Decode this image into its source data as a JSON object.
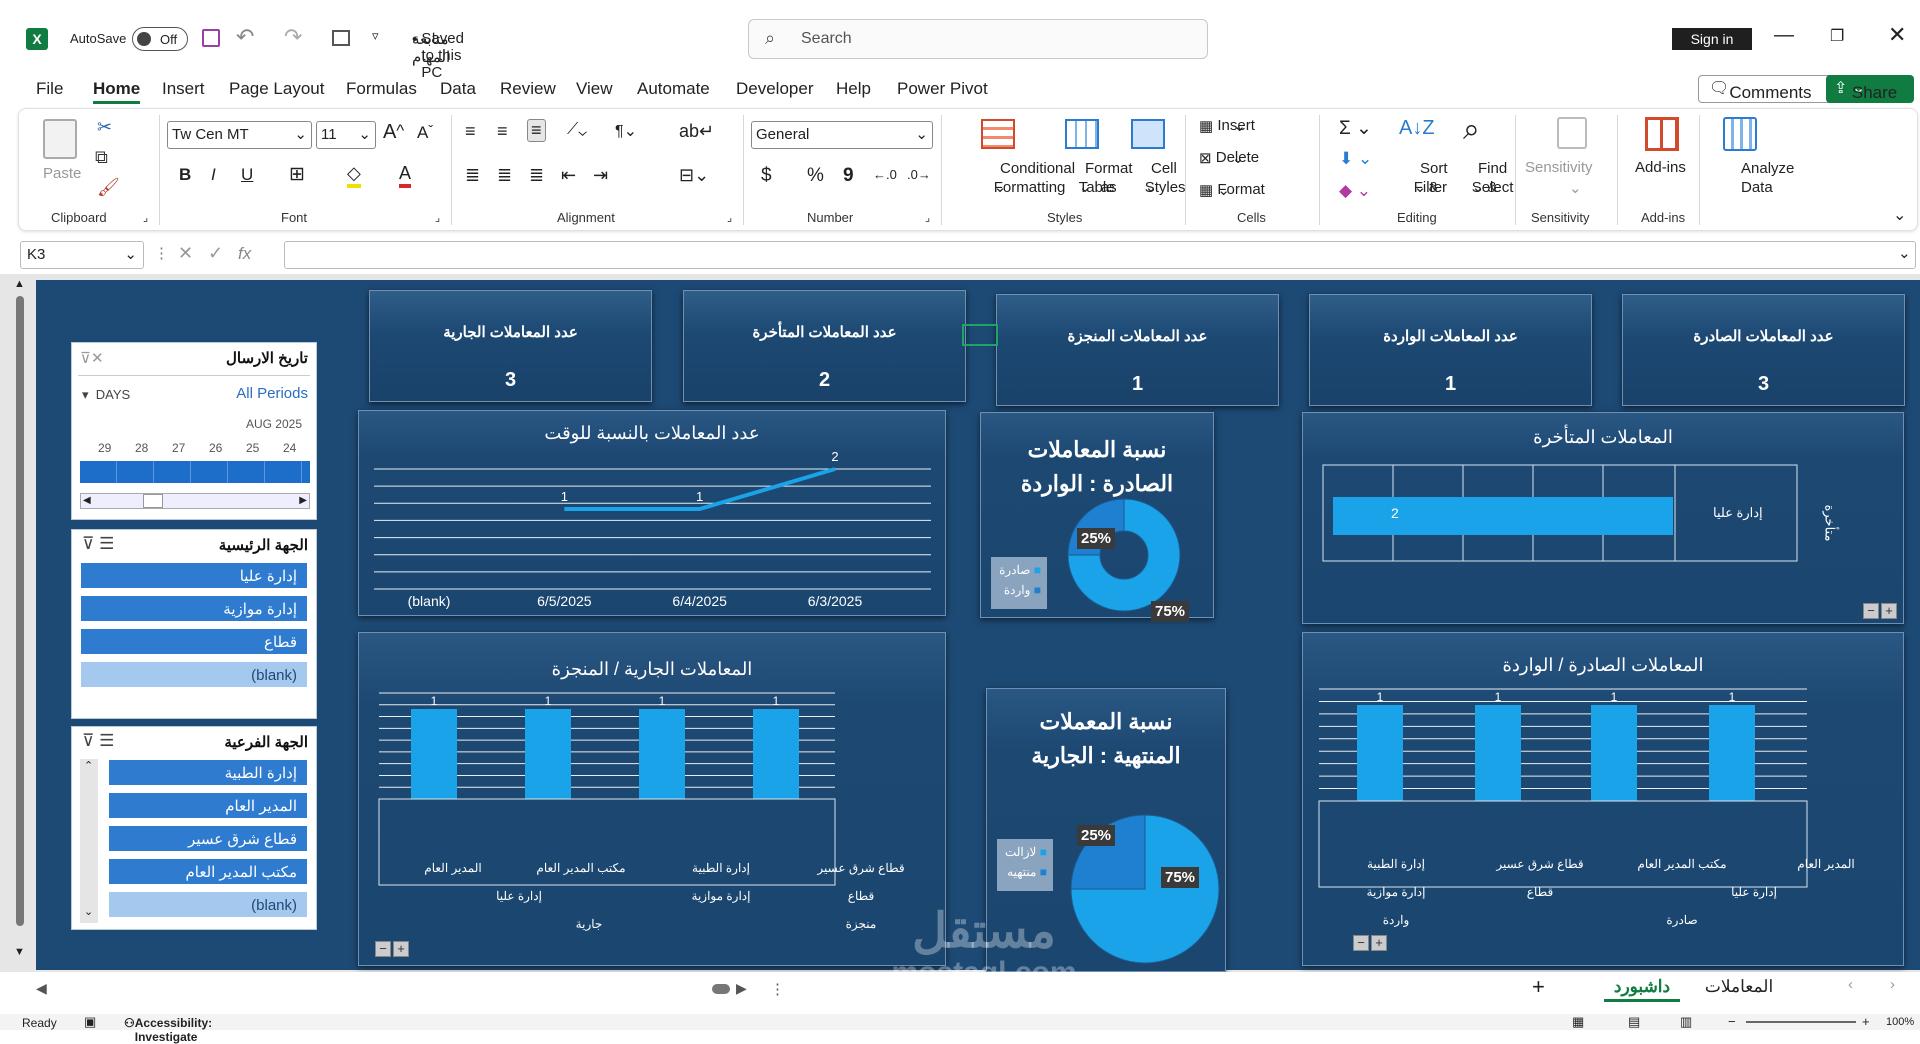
{
  "titlebar": {
    "autosave_label": "AutoSave",
    "autosave_state": "Off",
    "doc_title": "متابعة المهام",
    "saved_status": "Saved to this PC",
    "search_placeholder": "Search",
    "sign_in": "Sign in"
  },
  "menu": [
    "File",
    "Home",
    "Insert",
    "Page Layout",
    "Formulas",
    "Data",
    "Review",
    "View",
    "Automate",
    "Developer",
    "Help",
    "Power Pivot"
  ],
  "header_buttons": {
    "comments": "Comments",
    "share": "Share"
  },
  "ribbon": {
    "clipboard": {
      "paste": "Paste",
      "group": "Clipboard"
    },
    "font": {
      "name": "Tw Cen MT",
      "size": "11",
      "group": "Font",
      "bold": "B",
      "italic": "I",
      "underline": "U"
    },
    "alignment": {
      "group": "Alignment"
    },
    "number": {
      "format": "General",
      "currency": "$",
      "percent": "%",
      "comma": "9",
      "group": "Number"
    },
    "styles": {
      "cond1": "Conditional",
      "cond2": "Formatting",
      "fmt1": "Format as",
      "fmt2": "Table",
      "cell1": "Cell",
      "cell2": "Styles",
      "group": "Styles"
    },
    "cells": {
      "insert": "Insert",
      "delete": "Delete",
      "format": "Format",
      "group": "Cells"
    },
    "editing": {
      "sort1": "Sort &",
      "sort2": "Filter",
      "find1": "Find &",
      "find2": "Select",
      "group": "Editing"
    },
    "sensitivity": {
      "label": "Sensitivity",
      "group": "Sensitivity"
    },
    "addins": {
      "label": "Add-ins",
      "group": "Add-ins"
    },
    "analyze": {
      "l1": "Analyze",
      "l2": "Data"
    }
  },
  "formula_bar": {
    "name_box": "K3",
    "fx": "fx",
    "value": ""
  },
  "dashboard": {
    "cards": [
      {
        "title": "عدد المعاملات الجارية",
        "value": "3"
      },
      {
        "title": "عدد المعاملات المتأخرة",
        "value": "2"
      },
      {
        "title": "عدد المعاملات المنجزة",
        "value": "1"
      },
      {
        "title": "عدد المعاملات الواردة",
        "value": "1"
      },
      {
        "title": "عدد المعاملات الصادرة",
        "value": "3"
      }
    ],
    "slicer_date": {
      "title": "تاريخ الارسال",
      "level": "DAYS",
      "all_periods": "All Periods",
      "month": "AUG 2025",
      "days": [
        "29",
        "28",
        "27",
        "26",
        "25",
        "24"
      ]
    },
    "slicer_main": {
      "title": "الجهة الرئيسية",
      "items": [
        "إدارة عليا",
        "إدارة موازية",
        "قطاع",
        "(blank)"
      ]
    },
    "slicer_sub": {
      "title": "الجهة الفرعية",
      "items": [
        "إدارة الطبية",
        "المدير العام",
        "قطاع شرق عسير",
        "مكتب المدير العام",
        "(blank)"
      ]
    },
    "line_panel": {
      "title": "عدد المعاملات بالنسبة للوقت"
    },
    "donut1": {
      "title1": "نسبة المعاملات",
      "title2": "الصادرة : الواردة",
      "legend": [
        "صادرة",
        "واردة"
      ],
      "label_small": "25%",
      "label_big": "75%"
    },
    "donut2": {
      "title1": "نسبة المعملات",
      "title2": "المنتهية : الجارية",
      "legend": [
        "لازالت",
        "منتهيه"
      ],
      "label_small": "25%",
      "label_big": "75%"
    },
    "late_panel": {
      "title": "المعاملات المتأخرة",
      "row_label": "إدارة عليا",
      "axis_title": "متأخرة",
      "value_label": "2"
    },
    "bar1_panel": {
      "title": "المعاملات الجارية / المنجزة",
      "sub_labels": [
        "المدير العام",
        "مكتب المدير العام",
        "إدارة الطبية",
        "قطاع شرق عسير"
      ],
      "grp_labels": [
        "إدارة عليا",
        "إدارة موازية",
        "قطاع"
      ],
      "top_labels": [
        "جارية",
        "منجزة"
      ]
    },
    "bar2_panel": {
      "title": "المعاملات الصادرة / الواردة",
      "sub_labels": [
        "إدارة الطبية",
        "قطاع شرق عسير",
        "مكتب المدير العام",
        "المدير العام"
      ],
      "grp_labels": [
        "إدارة موازية",
        "قطاع",
        "إدارة عليا"
      ],
      "top_labels": [
        "واردة",
        "صادرة"
      ]
    }
  },
  "chart_data": [
    {
      "type": "line",
      "title": "عدد المعاملات بالنسبة للوقت",
      "categories": [
        "(blank)",
        "6/5/2025",
        "6/4/2025",
        "6/3/2025"
      ],
      "values": [
        null,
        1,
        1,
        2
      ]
    },
    {
      "type": "pie",
      "title": "نسبة المعاملات الصادرة : الواردة",
      "categories": [
        "صادرة",
        "واردة"
      ],
      "values": [
        75,
        25
      ]
    },
    {
      "type": "pie",
      "title": "نسبة المعملات المنتهية : الجارية",
      "categories": [
        "لازالت",
        "منتهيه"
      ],
      "values": [
        75,
        25
      ]
    },
    {
      "type": "bar",
      "title": "المعاملات المتأخرة",
      "categories": [
        "إدارة عليا"
      ],
      "values": [
        2
      ]
    },
    {
      "type": "bar",
      "title": "المعاملات الجارية / المنجزة",
      "categories": [
        "المدير العام",
        "مكتب المدير العام",
        "إدارة الطبية",
        "قطاع شرق عسير"
      ],
      "values": [
        1,
        1,
        1,
        1
      ]
    },
    {
      "type": "bar",
      "title": "المعاملات الصادرة / الواردة",
      "categories": [
        "إدارة الطبية",
        "قطاع شرق عسير",
        "مكتب المدير العام",
        "المدير العام"
      ],
      "values": [
        1,
        1,
        1,
        1
      ]
    }
  ],
  "sheet_tabs": {
    "active": "داشبورد",
    "other": "المعاملات",
    "add": "+"
  },
  "status": {
    "ready": "Ready",
    "accessibility": "Accessibility: Investigate",
    "zoom": "100%"
  },
  "watermark": {
    "text": "mostaql.com",
    "logo": "مستقل"
  },
  "colors": {
    "excel_green": "#107c41",
    "dash_bg": "#1d4a75",
    "bar_blue": "#1aa3e8",
    "slicer_blue": "#2e7bd0"
  }
}
